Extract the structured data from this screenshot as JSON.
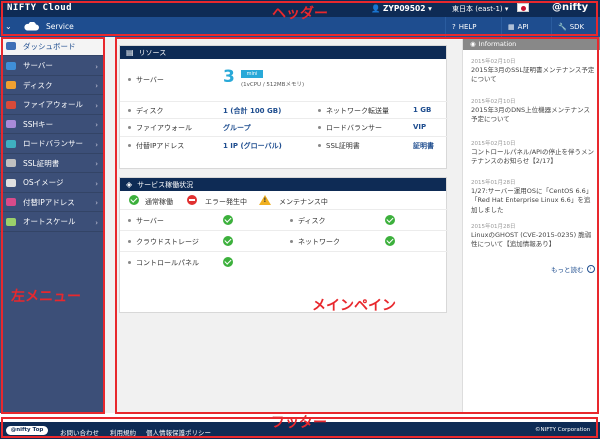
{
  "header": {
    "brand": "NIFTY Cloud",
    "annotation": "ヘッダー",
    "account": "ZYP09502",
    "account_arrow": "▾",
    "region": "東日本 (east-1)",
    "region_arrow": "▾",
    "user": "@nifty",
    "menu_chevron": "⌄",
    "service": "Service",
    "help": "HELP",
    "api": "API",
    "sdk": "SDK"
  },
  "sidebar": {
    "annotation": "左メニュー",
    "items": [
      {
        "label": "ダッシュボード",
        "icon": "dashboard-icon",
        "color": "#3f6fb6"
      },
      {
        "label": "サーバー",
        "icon": "server-icon",
        "color": "#3f8fd8"
      },
      {
        "label": "ディスク",
        "icon": "disk-icon",
        "color": "#f0a030"
      },
      {
        "label": "ファイアウォール",
        "icon": "firewall-icon",
        "color": "#d94b3a"
      },
      {
        "label": "SSHキー",
        "icon": "ssh-key-icon",
        "color": "#a98ad8"
      },
      {
        "label": "ロードバランサー",
        "icon": "load-balancer-icon",
        "color": "#3fb0c0"
      },
      {
        "label": "SSL証明書",
        "icon": "ssl-certificate-icon",
        "color": "#c0c0c0"
      },
      {
        "label": "OSイメージ",
        "icon": "os-image-icon",
        "color": "#e0e0e0"
      },
      {
        "label": "付替IPアドレス",
        "icon": "floating-ip-icon",
        "color": "#d94b8a"
      },
      {
        "label": "オートスケール",
        "icon": "autoscale-icon",
        "color": "#9ad06a"
      }
    ],
    "arrow": "›"
  },
  "main": {
    "annotation": "メインペイン",
    "resource": {
      "title": "リソース",
      "server_label": "サーバー",
      "server_count": "3",
      "server_badge": "mini",
      "server_spec": "(1vCPU / 512MBメモリ)",
      "disk_label": "ディスク",
      "disk_value": "1 (合計 100 GB)",
      "transfer_label": "ネットワーク転送量",
      "transfer_value": "1 GB",
      "fw_label": "ファイアウォール",
      "fw_value": "グループ",
      "lb_label": "ロードバランサー",
      "lb_value": "VIP",
      "ip_label": "付替IPアドレス",
      "ip_value": "1 IP (グローバル)",
      "ssl_label": "SSL証明書",
      "ssl_value": "証明書"
    },
    "status": {
      "title": "サービス稼働状況",
      "legend_ok": "通常稼働",
      "legend_err": "エラー発生中",
      "legend_maint": "メンテナンス中",
      "items": [
        "サーバー",
        "ディスク",
        "クラウドストレージ",
        "ネットワーク",
        "コントロールパネル"
      ]
    }
  },
  "info": {
    "title": "Information",
    "news": [
      {
        "date": "2015年02月10日",
        "text": "2015年3月のSSL証明書メンテナンス予定について"
      },
      {
        "date": "2015年02月10日",
        "text": "2015年3月のDNS上位機器メンテナンス予定について"
      },
      {
        "date": "2015年02月10日",
        "text": "コントロールパネル/APIの停止を伴うメンテナンスのお知らせ【2/17】"
      },
      {
        "date": "2015年01月28日",
        "text": "1/27:サーバー運用OSに「CentOS 6.6」「Red Hat Enterprise Linux 6.6」を追加しました"
      },
      {
        "date": "2015年01月28日",
        "text": "LinuxのGHOST (CVE-2015-0235) 脆弱性について【追加情報あり】"
      }
    ],
    "more": "もっと読む"
  },
  "footer": {
    "annotation": "フッター",
    "top": "@nifty Top",
    "contact": "お問い合わせ",
    "terms": "利用規約",
    "privacy": "個人情報保護ポリシー",
    "copyright": "©NIFTY Corporation"
  }
}
